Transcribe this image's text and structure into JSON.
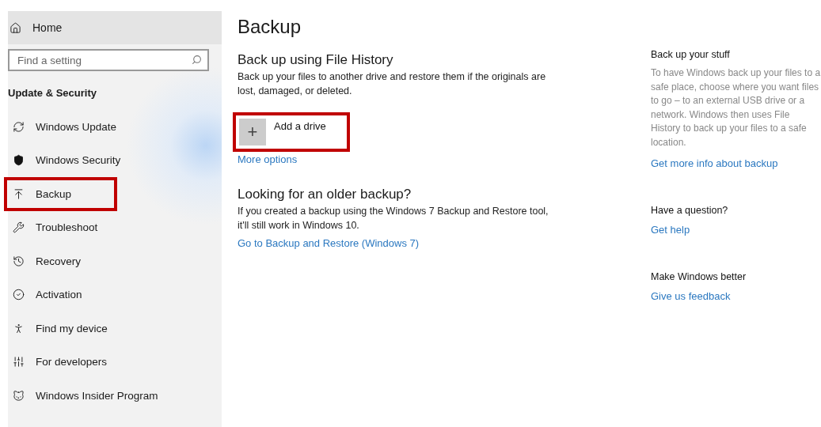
{
  "sidebar": {
    "home": {
      "label": "Home",
      "selected": true
    },
    "search": {
      "placeholder": "Find a setting"
    },
    "section_title": "Update & Security",
    "items": [
      {
        "label": "Windows Update",
        "highlighted": false
      },
      {
        "label": "Windows Security",
        "highlighted": false
      },
      {
        "label": "Backup",
        "highlighted": true
      },
      {
        "label": "Troubleshoot",
        "highlighted": false
      },
      {
        "label": "Recovery",
        "highlighted": false
      },
      {
        "label": "Activation",
        "highlighted": false
      },
      {
        "label": "Find my device",
        "highlighted": false
      },
      {
        "label": "For developers",
        "highlighted": false
      },
      {
        "label": "Windows Insider Program",
        "highlighted": false
      }
    ]
  },
  "main": {
    "title": "Backup",
    "file_history": {
      "heading": "Back up using File History",
      "text": "Back up your files to another drive and restore them if the originals are lost, damaged, or deleted.",
      "add_button": {
        "icon": "+",
        "label": "Add a drive",
        "highlighted": true
      },
      "link": "More options"
    },
    "older": {
      "heading": "Looking for an older backup?",
      "text": "If you created a backup using the Windows 7 Backup and Restore tool, it'll still work in Windows 10.",
      "link": "Go to Backup and Restore (Windows 7)"
    }
  },
  "aside": [
    {
      "heading": "Back up your stuff",
      "text": "To have Windows back up your files to a safe place, choose where you want files to go – to an external USB drive or a network. Windows then uses File History to back up your files to a safe location.",
      "link": "Get more info about backup"
    },
    {
      "heading": "Have a question?",
      "link": "Get help"
    },
    {
      "heading": "Make Windows better",
      "link": "Give us feedback"
    }
  ]
}
